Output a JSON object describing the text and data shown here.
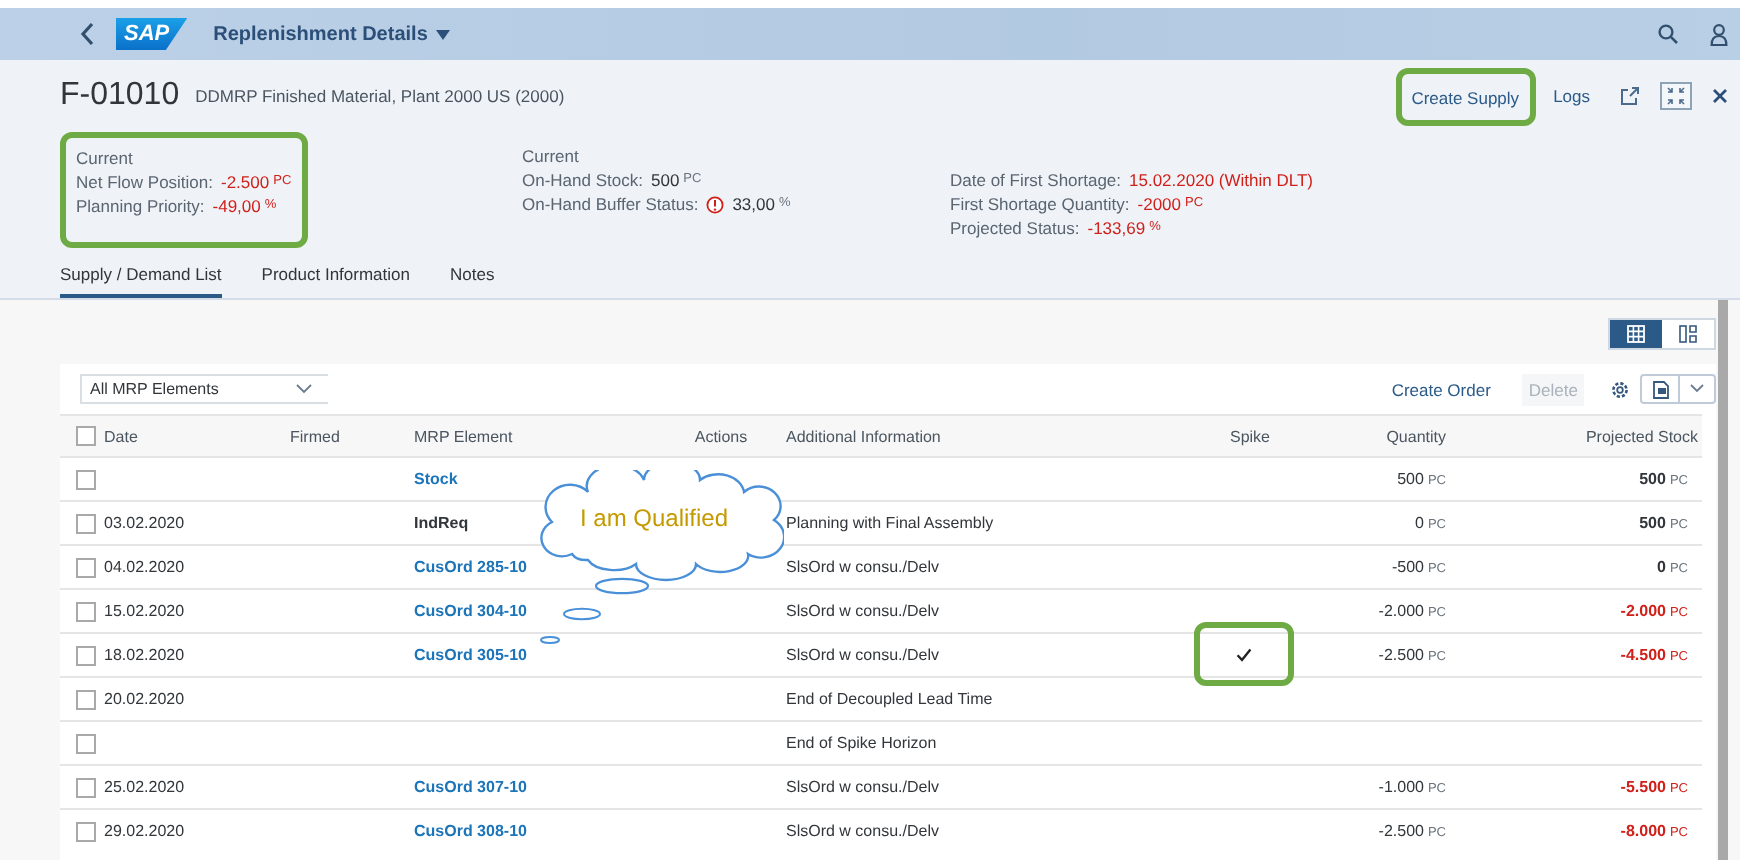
{
  "shell": {
    "logo": "SAP",
    "title": "Replenishment Details"
  },
  "header": {
    "id": "F-01010",
    "description": "DDMRP Finished Material, Plant 2000 US (2000)",
    "actions": [
      {
        "label": "Create Supply",
        "highlighted": true
      },
      {
        "label": "Logs",
        "highlighted": false
      }
    ],
    "facets": [
      {
        "title": "Current",
        "highlighted": true,
        "fields": [
          {
            "label": "Net Flow Position:",
            "value": "-2.500",
            "unit": "PC",
            "negative": true
          },
          {
            "label": "Planning Priority:",
            "value": "-49,00",
            "unit": "%",
            "negative": true
          }
        ]
      },
      {
        "title": "Current",
        "highlighted": false,
        "fields": [
          {
            "label": "On-Hand Stock:",
            "value": "500",
            "unit": "PC",
            "negative": false
          },
          {
            "label": "On-Hand Buffer Status:",
            "value": "33,00",
            "unit": "%",
            "negative": false,
            "alert": true
          }
        ]
      },
      {
        "highlighted": false,
        "fields": [
          {
            "label": "Date of First Shortage:",
            "value": "15.02.2020 (Within DLT)",
            "negative": true
          },
          {
            "label": "First Shortage Quantity:",
            "value": "-2000",
            "unit": "PC",
            "negative": true
          },
          {
            "label": "Projected Status:",
            "value": "-133,69",
            "unit": "%",
            "negative": true
          }
        ]
      }
    ]
  },
  "tabs": [
    {
      "label": "Supply / Demand List",
      "selected": true
    },
    {
      "label": "Product Information",
      "selected": false
    },
    {
      "label": "Notes",
      "selected": false
    }
  ],
  "view_toggle": [
    {
      "kind": "table",
      "selected": true
    },
    {
      "kind": "chart",
      "selected": false
    }
  ],
  "table": {
    "filter": {
      "value": "All MRP Elements"
    },
    "toolbar": [
      {
        "label": "Create Order",
        "disabled": false
      },
      {
        "label": "Delete",
        "disabled": true
      }
    ],
    "all_selected": false,
    "columns": [
      "Date",
      "Firmed",
      "MRP Element",
      "Actions",
      "Additional Information",
      "Spike",
      "Quantity",
      "Projected Stock"
    ],
    "rows": [
      {
        "selected": false,
        "element": {
          "text": "Stock",
          "kind": "link"
        },
        "spike": false,
        "quantity": "500",
        "quantity_unit": "PC",
        "stock": "500",
        "stock_unit": "PC",
        "stock_negative": false
      },
      {
        "selected": false,
        "date": "03.02.2020",
        "element": {
          "text": "IndReq",
          "kind": "plain"
        },
        "info": "Planning with Final Assembly",
        "spike": false,
        "quantity": "0",
        "quantity_unit": "PC",
        "stock": "500",
        "stock_unit": "PC",
        "stock_negative": false
      },
      {
        "selected": false,
        "date": "04.02.2020",
        "element": {
          "text": "CusOrd 285-10",
          "kind": "link"
        },
        "info": "SlsOrd w consu./Delv",
        "spike": false,
        "quantity": "-500",
        "quantity_unit": "PC",
        "stock": "0",
        "stock_unit": "PC",
        "stock_negative": false
      },
      {
        "selected": false,
        "date": "15.02.2020",
        "element": {
          "text": "CusOrd 304-10",
          "kind": "link"
        },
        "info": "SlsOrd w consu./Delv",
        "spike": false,
        "quantity": "-2.000",
        "quantity_unit": "PC",
        "stock": "-2.000",
        "stock_unit": "PC",
        "stock_negative": true
      },
      {
        "selected": false,
        "date": "18.02.2020",
        "element": {
          "text": "CusOrd 305-10",
          "kind": "link"
        },
        "info": "SlsOrd w consu./Delv",
        "spike": true,
        "spike_highlighted": true,
        "quantity": "-2.500",
        "quantity_unit": "PC",
        "stock": "-4.500",
        "stock_unit": "PC",
        "stock_negative": true
      },
      {
        "selected": false,
        "date": "20.02.2020",
        "info": "End of Decoupled Lead Time",
        "spike": false
      },
      {
        "selected": false,
        "info": "End of Spike Horizon",
        "spike": false
      },
      {
        "selected": false,
        "date": "25.02.2020",
        "element": {
          "text": "CusOrd 307-10",
          "kind": "link"
        },
        "info": "SlsOrd w consu./Delv",
        "spike": false,
        "quantity": "-1.000",
        "quantity_unit": "PC",
        "stock": "-5.500",
        "stock_unit": "PC",
        "stock_negative": true
      },
      {
        "selected": false,
        "date": "29.02.2020",
        "element": {
          "text": "CusOrd 308-10",
          "kind": "link"
        },
        "info": "SlsOrd w consu./Delv",
        "spike": false,
        "quantity": "-2.500",
        "quantity_unit": "PC",
        "stock": "-8.000",
        "stock_unit": "PC",
        "stock_negative": true
      }
    ]
  },
  "callout": {
    "text": "I am Qualified"
  }
}
